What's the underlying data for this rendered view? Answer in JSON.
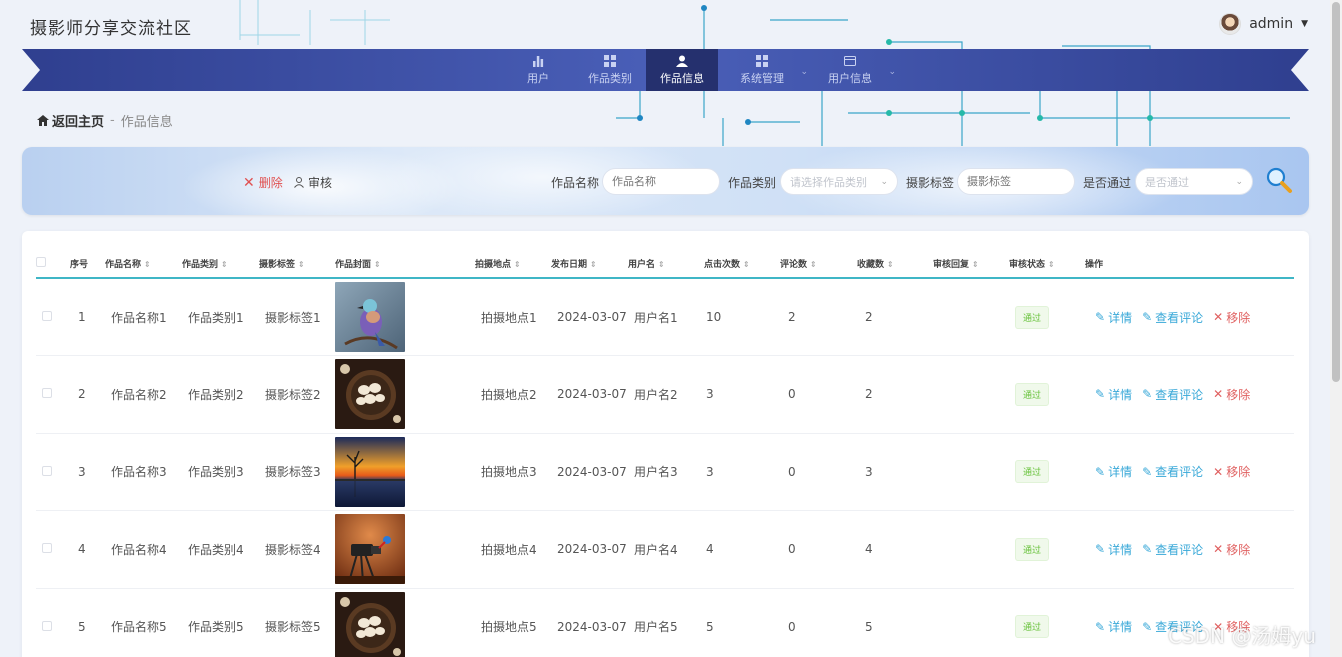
{
  "header": {
    "site_title": "摄影师分享交流社区",
    "user_name": "admin"
  },
  "nav": {
    "items": [
      {
        "label": "用户",
        "icon": "bar-chart-icon",
        "active": false,
        "dropdown": false
      },
      {
        "label": "作品类别",
        "icon": "grid-icon",
        "active": false,
        "dropdown": false
      },
      {
        "label": "作品信息",
        "icon": "user-icon",
        "active": true,
        "dropdown": false
      },
      {
        "label": "系统管理",
        "icon": "grid-icon",
        "active": false,
        "dropdown": true
      },
      {
        "label": "用户信息",
        "icon": "card-icon",
        "active": false,
        "dropdown": true
      }
    ]
  },
  "breadcrumb": {
    "home": "返回主页",
    "separator": "-",
    "current": "作品信息"
  },
  "filter": {
    "delete_label": "删除",
    "audit_label": "审核",
    "name_label": "作品名称",
    "name_placeholder": "作品名称",
    "category_label": "作品类别",
    "category_placeholder": "请选择作品类别",
    "tag_label": "摄影标签",
    "tag_placeholder": "摄影标签",
    "pass_label": "是否通过",
    "pass_placeholder": "是否通过"
  },
  "table": {
    "headers": [
      "序号",
      "作品名称",
      "作品类别",
      "摄影标签",
      "作品封面",
      "拍摄地点",
      "发布日期",
      "用户名",
      "点击次数",
      "评论数",
      "收藏数",
      "审核回复",
      "审核状态",
      "操作"
    ],
    "action_labels": {
      "detail": "详情",
      "comment": "查看评论",
      "remove": "移除"
    },
    "rows": [
      {
        "no": "1",
        "name": "作品名称1",
        "category": "作品类别1",
        "tag": "摄影标签1",
        "cover": "bird",
        "location": "拍摄地点1",
        "date": "2024-03-07",
        "user": "用户名1",
        "clicks": "10",
        "comments": "2",
        "favorites": "2",
        "reply": "",
        "status": "通过"
      },
      {
        "no": "2",
        "name": "作品名称2",
        "category": "作品类别2",
        "tag": "摄影标签2",
        "cover": "food",
        "location": "拍摄地点2",
        "date": "2024-03-07",
        "user": "用户名2",
        "clicks": "3",
        "comments": "0",
        "favorites": "2",
        "reply": "",
        "status": "通过"
      },
      {
        "no": "3",
        "name": "作品名称3",
        "category": "作品类别3",
        "tag": "摄影标签3",
        "cover": "sunset",
        "location": "拍摄地点3",
        "date": "2024-03-07",
        "user": "用户名3",
        "clicks": "3",
        "comments": "0",
        "favorites": "3",
        "reply": "",
        "status": "通过"
      },
      {
        "no": "4",
        "name": "作品名称4",
        "category": "作品类别4",
        "tag": "摄影标签4",
        "cover": "camera",
        "location": "拍摄地点4",
        "date": "2024-03-07",
        "user": "用户名4",
        "clicks": "4",
        "comments": "0",
        "favorites": "4",
        "reply": "",
        "status": "通过"
      },
      {
        "no": "5",
        "name": "作品名称5",
        "category": "作品类别5",
        "tag": "摄影标签5",
        "cover": "food",
        "location": "拍摄地点5",
        "date": "2024-03-07",
        "user": "用户名5",
        "clicks": "5",
        "comments": "0",
        "favorites": "5",
        "reply": "",
        "status": "通过"
      }
    ]
  },
  "watermark": "CSDN @汤姆yu",
  "colors": {
    "nav": "#3a4ba6",
    "accent": "#3fb6c6",
    "link": "#38a8d8",
    "danger": "#e06060",
    "pass": "#67c23a"
  }
}
